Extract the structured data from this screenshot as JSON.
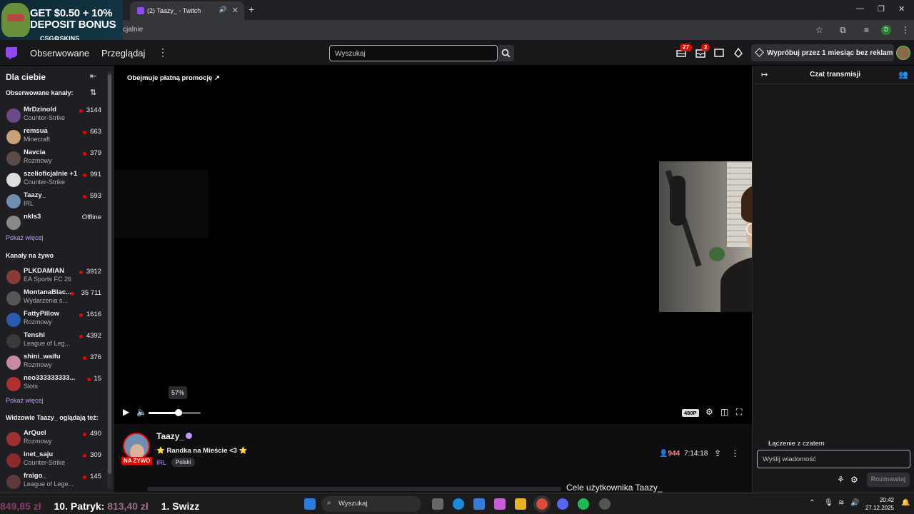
{
  "browser": {
    "tab_title": "(2) Taazy_ - Twitch",
    "address_fragment": "cjalnie",
    "profile_letter": "D"
  },
  "ad": {
    "line1": "GET $0.50 + 10%",
    "line2": "DEPOSIT BONUS",
    "brand": "CSG⚙SKINS"
  },
  "nav": {
    "following": "Obserwowane",
    "browse": "Przeglądaj",
    "search_placeholder": "Wyszukaj",
    "notifications_count": "27",
    "inbox_count": "2",
    "promo_text": "Wypróbuj przez 1 miesiąc bez reklam"
  },
  "sidebar": {
    "title": "Dla ciebie",
    "followed_heading": "Obserwowane kanały:",
    "followed": [
      {
        "name": "MrDzinold",
        "category": "Counter-Strike",
        "viewers": "3144",
        "avatar_color": "#6b4a8a"
      },
      {
        "name": "remsua",
        "category": "Minecraft",
        "viewers": "663",
        "avatar_color": "#c9a27a"
      },
      {
        "name": "Navcia",
        "category": "Rozmowy",
        "viewers": "379",
        "avatar_color": "#5a4a48"
      },
      {
        "name": "szelioficjalnie +1",
        "category": "Counter-Strike",
        "viewers": "991",
        "avatar_color": "#ddd"
      },
      {
        "name": "Taazy_",
        "category": "IRL",
        "viewers": "593",
        "avatar_color": "#6f8fb0"
      },
      {
        "name": "nkls3",
        "category": "",
        "viewers": "Offline",
        "avatar_color": "#888"
      }
    ],
    "show_more_1": "Pokaż więcej",
    "live_heading": "Kanały na żywo",
    "live": [
      {
        "name": "PLKDAMIAN",
        "category": "EA Sports FC 26",
        "viewers": "3912",
        "avatar_color": "#8a3a3a"
      },
      {
        "name": "MontanaBlac...",
        "category": "Wydarzenia s...",
        "viewers": "35 711",
        "avatar_color": "#555"
      },
      {
        "name": "FattyPillow",
        "category": "Rozmowy",
        "viewers": "1616",
        "avatar_color": "#2a5ab0"
      },
      {
        "name": "Tenshi",
        "category": "League of Leg...",
        "viewers": "4392",
        "avatar_color": "#3a3a3a"
      },
      {
        "name": "shini_waifu",
        "category": "Rozmowy",
        "viewers": "376",
        "avatar_color": "#c88aa0"
      },
      {
        "name": "neo333333333...",
        "category": "Slots",
        "viewers": "15",
        "avatar_color": "#b03030"
      }
    ],
    "show_more_2": "Pokaż więcej",
    "also_heading": "Widzowie Taazy_ oglądają też:",
    "also": [
      {
        "name": "ArQuel",
        "category": "Rozmowy",
        "viewers": "490",
        "avatar_color": "#a03030"
      },
      {
        "name": "inet_saju",
        "category": "Counter-Strike",
        "viewers": "309",
        "avatar_color": "#8a2a2a"
      },
      {
        "name": "fraigo_",
        "category": "League of Lege...",
        "viewers": "145",
        "avatar_color": "#5a3a3a"
      }
    ]
  },
  "player": {
    "paid_promo": "Obejmuje płatną promocję",
    "volume_tooltip": "57%",
    "volume": 0.57,
    "quality": "480P"
  },
  "stream": {
    "streamer": "Taazy_",
    "live_badge": "NA ŻYWO",
    "title": "⭐ Randka na Mieście <3 ⭐",
    "category": "IRL",
    "language": "Polski",
    "viewers": "944",
    "uptime": "7:14:18",
    "goals_heading": "Cele użytkownika Taazy_"
  },
  "chat": {
    "title": "Czat transmisji",
    "status": "Łączenie z czatem",
    "input_placeholder": "Wyślij wiadomość",
    "send_label": "Rozmawiaj"
  },
  "taskbar": {
    "ticker_value": "849,85 zł",
    "ticker_rank": "10. Patryk:",
    "ticker_rank_value": "813,40 zł",
    "ticker_next": "1. Swizz",
    "search_label": "Wyszukaj",
    "time": "20:42",
    "date": "27.12.2025"
  }
}
